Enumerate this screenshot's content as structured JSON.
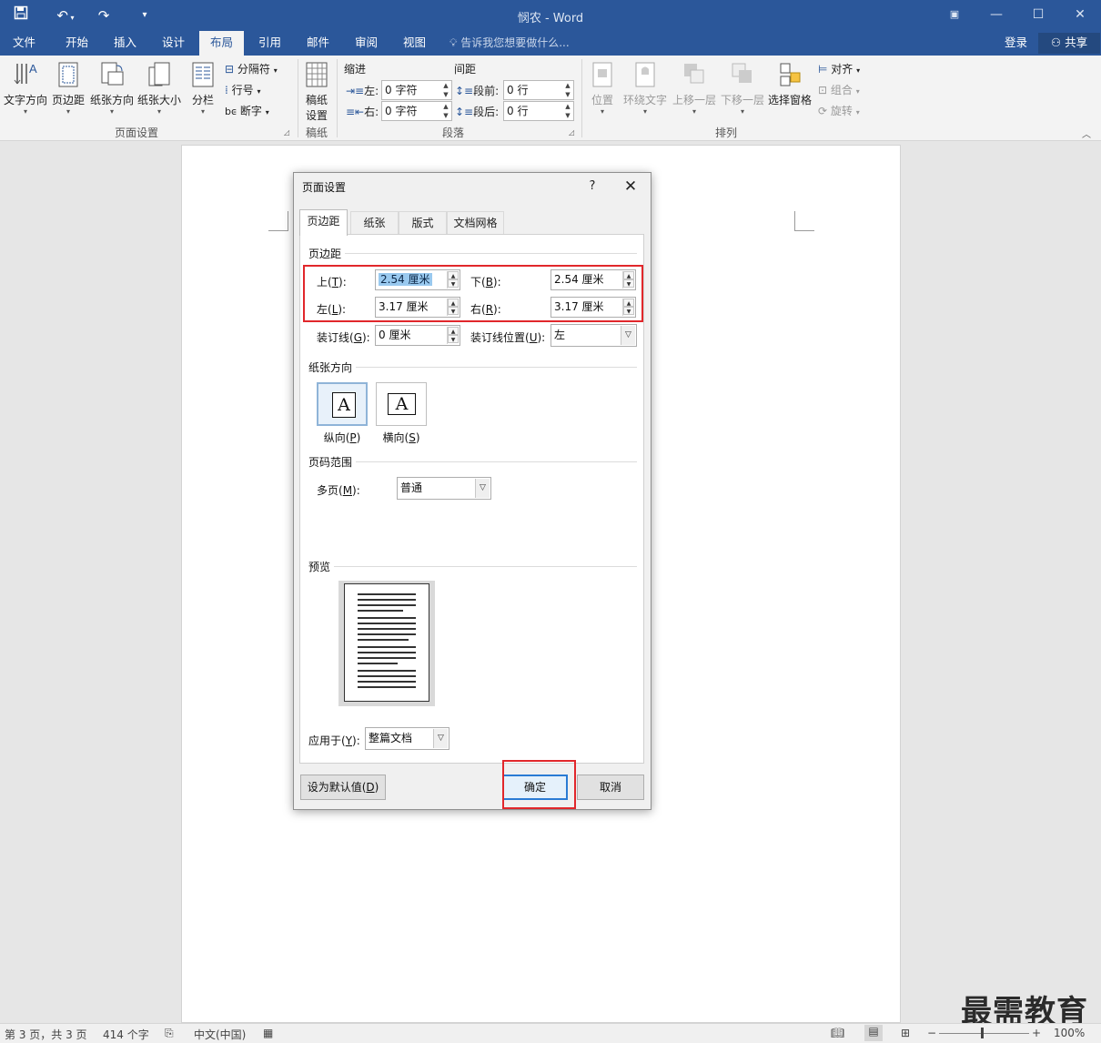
{
  "window": {
    "title": "悯农 - Word",
    "quick_access": [
      "save-icon",
      "undo-icon",
      "redo-icon",
      "customize-icon"
    ],
    "controls": [
      "restore-ribbon-icon",
      "minimize-icon",
      "maximize-icon",
      "close-icon"
    ]
  },
  "tabs": [
    {
      "label": "文件"
    },
    {
      "label": "开始"
    },
    {
      "label": "插入"
    },
    {
      "label": "设计"
    },
    {
      "label": "布局",
      "active": true
    },
    {
      "label": "引用"
    },
    {
      "label": "邮件"
    },
    {
      "label": "审阅"
    },
    {
      "label": "视图"
    }
  ],
  "tell_me": "告诉我您想要做什么...",
  "login": "登录",
  "share": "共享",
  "ribbon": {
    "page_setup": {
      "label": "页面设置",
      "text_direction": "文字方向",
      "margins": "页边距",
      "orientation": "纸张方向",
      "size": "纸张大小",
      "columns": "分栏",
      "breaks": "分隔符",
      "line_numbers": "行号",
      "hyphenation": "断字"
    },
    "manuscript": {
      "label": "稿纸",
      "button_line1": "稿纸",
      "button_line2": "设置"
    },
    "paragraph": {
      "label": "段落",
      "indent": "缩进",
      "spacing": "间距",
      "left_label": "左:",
      "right_label": "右:",
      "before_label": "段前:",
      "after_label": "段后:",
      "left_value": "0 字符",
      "right_value": "0 字符",
      "before_value": "0 行",
      "after_value": "0 行"
    },
    "arrange": {
      "label": "排列",
      "position": "位置",
      "wrap_text": "环绕文字",
      "bring_forward": "上移一层",
      "send_backward": "下移一层",
      "selection_pane": "选择窗格",
      "align": "对齐",
      "group": "组合",
      "rotate": "旋转"
    }
  },
  "dialog": {
    "title": "页面设置",
    "help": "?",
    "close": "✕",
    "tabs": [
      "页边距",
      "纸张",
      "版式",
      "文档网格"
    ],
    "margins_section": "页边距",
    "top_label": "上(",
    "top_key": "T",
    "top_value": "2.54 厘米",
    "bottom_label": "下(",
    "bottom_key": "B",
    "bottom_value": "2.54 厘米",
    "left_label": "左(",
    "left_key": "L",
    "left_value": "3.17 厘米",
    "right_label": "右(",
    "right_key": "R",
    "right_value": "3.17 厘米",
    "gutter_label": "装订线(",
    "gutter_key": "G",
    "gutter_value": "0 厘米",
    "gutter_pos_label": "装订线位置(",
    "gutter_pos_key": "U",
    "gutter_pos_value": "左",
    "orientation_section": "纸张方向",
    "portrait": "纵向(",
    "portrait_key": "P",
    "landscape": "横向(",
    "landscape_key": "S",
    "orientation_glyph": "A",
    "pages_section": "页码范围",
    "multiple_pages_label": "多页(",
    "multiple_pages_key": "M",
    "multiple_pages_value": "普通",
    "preview_section": "预览",
    "apply_to_label": "应用于(",
    "apply_to_key": "Y",
    "apply_to_value": "整篇文档",
    "set_default": "设为默认值(",
    "set_default_key": "D",
    "ok": "确定",
    "cancel": "取消"
  },
  "status": {
    "page_info": "第 3 页，共 3 页",
    "word_count": "414 个字",
    "language": "中文(中国)",
    "zoom": "100%"
  },
  "watermark": "最需教育",
  "colors": {
    "accent": "#2b579a",
    "highlight_box": "#e1272b",
    "default_button": "#2a7bd4"
  }
}
